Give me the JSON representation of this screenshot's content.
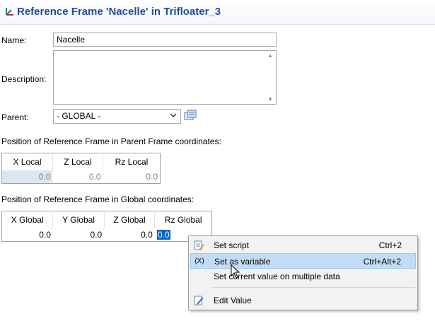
{
  "header": {
    "title": "Reference Frame 'Nacelle' in Trifloater_3"
  },
  "form": {
    "name_label": "Name:",
    "name_value": "Nacelle",
    "description_label": "Description:",
    "description_value": "",
    "parent_label": "Parent:",
    "parent_value": "- GLOBAL -"
  },
  "local_section": {
    "title": "Position of Reference Frame in Parent Frame coordinates:",
    "columns": [
      "X Local",
      "Z Local",
      "Rz Local"
    ],
    "values": [
      "0.0",
      "0.0",
      "0.0"
    ]
  },
  "global_section": {
    "title": "Position of Reference Frame in Global coordinates:",
    "columns": [
      "X Global",
      "Y Global",
      "Z Global",
      "Rz Global"
    ],
    "values": [
      "0.0",
      "0.0",
      "0.0",
      "0.0"
    ]
  },
  "context_menu": {
    "items": [
      {
        "label": "Set script",
        "shortcut": "Ctrl+2",
        "icon": "script-icon"
      },
      {
        "label": "Set as variable",
        "shortcut": "Ctrl+Alt+2",
        "icon_text": "(X)"
      },
      {
        "label": "Set current value on multiple data",
        "shortcut": ""
      },
      {
        "label": "Edit Value",
        "shortcut": "",
        "icon": "edit-icon"
      }
    ]
  },
  "colors": {
    "title": "#1f4e9a",
    "selection": "#0a64c8",
    "menu_highlight": "#c3dcf5"
  }
}
